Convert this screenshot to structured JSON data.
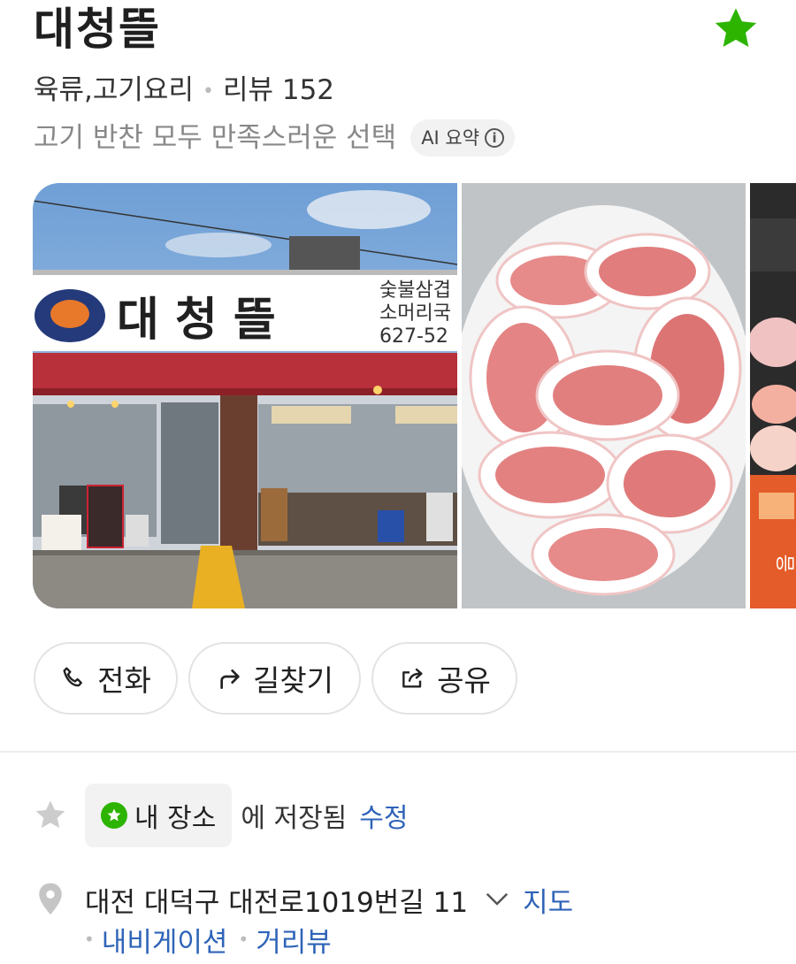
{
  "header": {
    "title": "대청뜰",
    "category": "육류,고기요리",
    "review_label": "리뷰 152",
    "summary": "고기 반찬 모두 만족스러운 선택",
    "ai_chip_label": "AI 요약"
  },
  "photos": {
    "sign_main": "대 청 뜰",
    "sign_side_1": "숯불삼겹",
    "sign_side_2": "소머리국",
    "sign_phone": "627-52",
    "tent_text": "음"
  },
  "actions": {
    "call_label": "전화",
    "route_label": "길찾기",
    "share_label": "공유"
  },
  "saved": {
    "chip_label": "내 장소",
    "text": "에 저장됨",
    "edit_label": "수정"
  },
  "address": {
    "text": "대전 대덕구 대전로1019번길 11",
    "map_label": "지도",
    "navigation_label": "내비게이션",
    "roadview_label": "거리뷰"
  },
  "colors": {
    "accent_green": "#2db400",
    "link_blue": "#2f64b8"
  }
}
